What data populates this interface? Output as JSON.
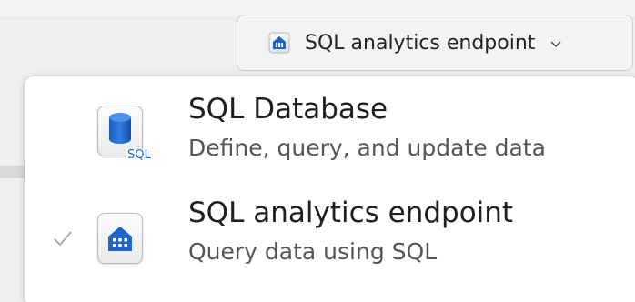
{
  "switcher": {
    "label": "SQL analytics endpoint",
    "icon": "warehouse-icon",
    "chevron": "chevron-down-icon"
  },
  "menu": {
    "items": [
      {
        "title": "SQL Database",
        "description": "Define, query, and update data",
        "icon": "sql-database-icon",
        "icon_tag": "SQL",
        "selected": false
      },
      {
        "title": "SQL analytics endpoint",
        "description": "Query data using SQL",
        "icon": "warehouse-icon",
        "selected": true
      }
    ]
  },
  "colors": {
    "accent": "#1e64c8",
    "check": "#9a9a9a",
    "text": "#1f1f1f",
    "subtext": "#555555"
  }
}
